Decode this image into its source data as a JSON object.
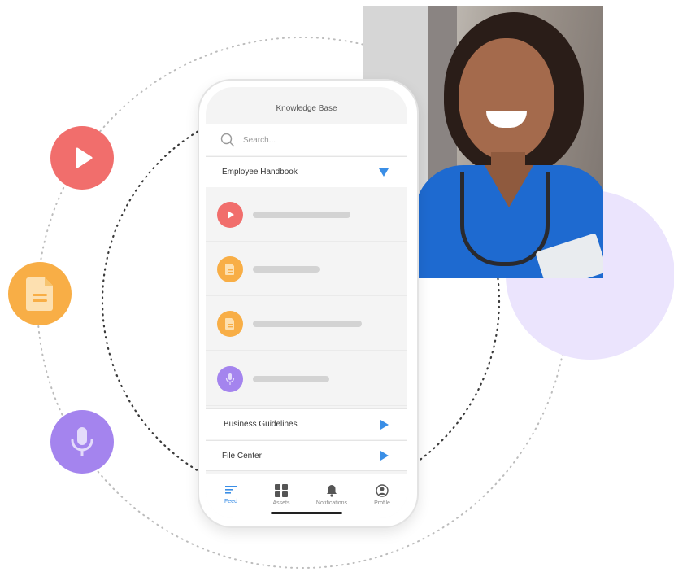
{
  "colors": {
    "accent": "#3a8ee6",
    "video": "#f16e6c",
    "document": "#f8ae46",
    "audio": "#a484ee",
    "lavender": "#ebe4fd"
  },
  "side_icons": [
    "play-icon",
    "document-icon",
    "microphone-icon"
  ],
  "app": {
    "title": "Knowledge Base",
    "search": {
      "placeholder": "Search..."
    },
    "sections": [
      {
        "label": "Employee Handbook",
        "state": "expanded"
      },
      {
        "label": "Business Guidelines",
        "state": "collapsed"
      },
      {
        "label": "File Center",
        "state": "collapsed"
      }
    ],
    "items": [
      {
        "type": "video",
        "icon": "play-icon"
      },
      {
        "type": "document",
        "icon": "document-icon"
      },
      {
        "type": "document",
        "icon": "document-icon"
      },
      {
        "type": "audio",
        "icon": "microphone-icon"
      }
    ],
    "tabs": [
      {
        "label": "Feed",
        "icon": "feed-icon",
        "active": true
      },
      {
        "label": "Assets",
        "icon": "grid-icon",
        "active": false
      },
      {
        "label": "Notifications",
        "icon": "bell-icon",
        "active": false
      },
      {
        "label": "Profile",
        "icon": "profile-icon",
        "active": false
      }
    ]
  }
}
